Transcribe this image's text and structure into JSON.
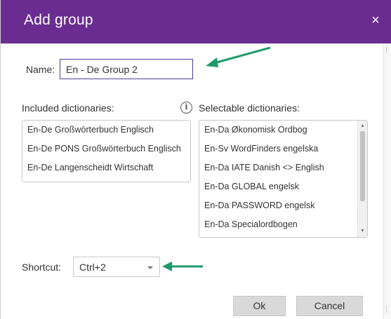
{
  "dialog": {
    "title": "Add group",
    "close_symbol": "×"
  },
  "name": {
    "label": "Name:",
    "value": "En - De Group 2"
  },
  "included": {
    "label": "Included dictionaries:",
    "items": [
      "En-De Großwörterbuch Englisch",
      "En-De PONS Großwörterbuch Englisch",
      "En-De Langenscheidt Wirtschaft"
    ]
  },
  "info_icon": "info-icon",
  "selectable": {
    "label": "Selectable dictionaries:",
    "items": [
      "En-Da Økonomisk Ordbog",
      "En-Sv WordFinders engelska",
      "En-Da IATE Danish <> English",
      "En-Da GLOBAL engelsk",
      "En-Da PASSWORD engelsk",
      "En-Da Specialordbogen"
    ]
  },
  "shortcut": {
    "label": "Shortcut:",
    "value": "Ctrl+2"
  },
  "buttons": {
    "ok": "Ok",
    "cancel": "Cancel"
  },
  "colors": {
    "titlebar": "#6a2c91",
    "annotation_arrow": "#1f9a6a"
  }
}
